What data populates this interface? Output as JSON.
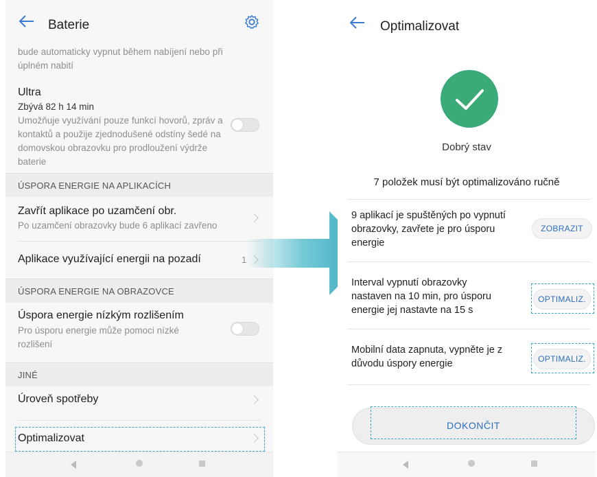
{
  "left": {
    "title": "Baterie",
    "partial_text": "bude automaticky vypnut během nabíjení nebo při úplném nabití",
    "ultra": {
      "title": "Ultra",
      "remaining": "Zbývá 82 h 14 min",
      "description": "Umožňuje využívání pouze funkcí hovorů, zpráv a kontaktů a použije zjednodušené odstíny šedé na domovskou obrazovku pro prodloužení výdrže baterie",
      "toggle_on": false
    },
    "section_apps": "ÚSPORA ENERGIE NA APLIKACÍCH",
    "close_apps": {
      "title": "Zavřít aplikace po uzamčení obr.",
      "subtitle": "Po uzamčení obrazovky bude 6 aplikací zavřeno"
    },
    "background_apps": {
      "title": "Aplikace využívající energii na pozadí",
      "count": "1"
    },
    "section_screen": "ÚSPORA ENERGIE NA OBRAZOVCE",
    "low_res": {
      "title": "Úspora energie nízkým rozlišením",
      "subtitle": "Pro úsporu energie může pomoci nízké rozlišení",
      "toggle_on": false
    },
    "section_other": "JINÉ",
    "consumption_level": "Úroveň spotřeby",
    "optimize": "Optimalizovat"
  },
  "right": {
    "title": "Optimalizovat",
    "status": "Dobrý stav",
    "needs_manual": "7 položek musí být optimalizováno ručně",
    "items": [
      {
        "text": "9 aplikací je spuštěných po vypnutí obrazovky, zavřete je pro úsporu energie",
        "action": "ZOBRAZIT"
      },
      {
        "text": "Interval vypnutí obrazovky nastaven na 10 min, pro úsporu energie jej nastavte na 15 s",
        "action": "OPTIMALIZ."
      },
      {
        "text": "Mobilní data zapnuta, vypněte je z důvodu úspory energie",
        "action": "OPTIMALIZ."
      }
    ],
    "finish": "DOKONČIT"
  },
  "colors": {
    "accent_blue": "#2b6fbd",
    "check_green": "#3aaa79",
    "highlight_dash": "#3aa3c9",
    "arrow_teal": "#47b7c9"
  }
}
